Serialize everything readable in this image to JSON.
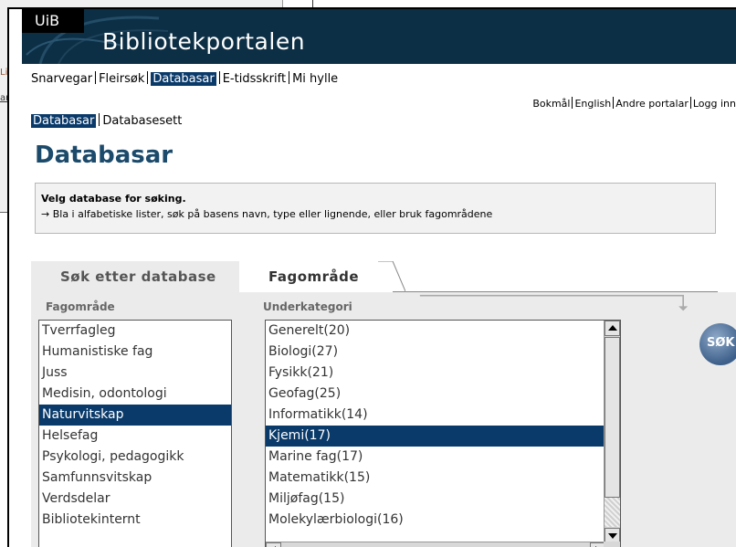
{
  "background_window": {
    "fragment_1": "Lib",
    "fragment_2": "and"
  },
  "banner": {
    "org": "UiB",
    "title": "Bibliotekportalen"
  },
  "main_nav": {
    "items": [
      "Snarvegar",
      "Fleirsøk",
      "Databasar",
      "E-tidsskrift",
      "Mi hylle"
    ],
    "selected": "Databasar"
  },
  "lang_nav": {
    "items": [
      "Bokmål",
      "English",
      "Andre portalar",
      "Logg inn"
    ]
  },
  "sub_nav": {
    "items": [
      "Databasar",
      "Databasesett"
    ],
    "selected": "Databasar"
  },
  "page": {
    "title": "Databasar"
  },
  "info": {
    "heading": "Velg database for søking.",
    "text": "→ Bla i alfabetiske lister, søk på basens navn, type eller lignende, eller bruk fagområdene"
  },
  "tabs": {
    "search": "Søk etter database",
    "subject": "Fagområde",
    "active": "Fagområde"
  },
  "subject_panel": {
    "subject_label": "Fagområde",
    "subcategory_label": "Underkategori",
    "subjects": [
      "Tverrfagleg",
      "Humanistiske fag",
      "Juss",
      "Medisin, odontologi",
      "Naturvitskap",
      "Helsefag",
      "Psykologi, pedagogikk",
      "Samfunnsvitskap",
      "Verdsdelar",
      "Bibliotekinternt"
    ],
    "selected_subject": "Naturvitskap",
    "subcategories": [
      "Generelt(20)",
      "Biologi(27)",
      "Fysikk(21)",
      "Geofag(25)",
      "Informatikk(14)",
      "Kjemi(17)",
      "Marine fag(17)",
      "Matematikk(15)",
      "Miljøfag(15)",
      "Molekylærbiologi(16)"
    ],
    "selected_subcategory": "Kjemi(17)",
    "search_button": "SØK"
  },
  "colors": {
    "banner": "#0c2f45",
    "selection": "#0a3a6a",
    "title": "#1c4a6b",
    "panel": "#ebebeb"
  }
}
